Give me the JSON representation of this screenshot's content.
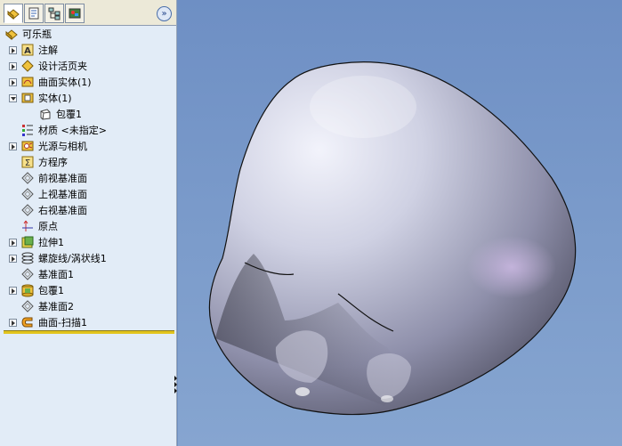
{
  "panel": {
    "tabs": [
      {
        "name": "feature-manager"
      },
      {
        "name": "property-manager"
      },
      {
        "name": "configuration-manager"
      },
      {
        "name": "display-manager"
      }
    ],
    "expand_glyph": "»"
  },
  "tree": {
    "root": "可乐瓶",
    "items": [
      {
        "label": "注解",
        "icon": "annotation-icon",
        "expander": "collapsed"
      },
      {
        "label": "设计活页夹",
        "icon": "design-binder-icon",
        "expander": "collapsed"
      },
      {
        "label": "曲面实体(1)",
        "icon": "surface-bodies-icon",
        "expander": "collapsed"
      },
      {
        "label": "实体(1)",
        "icon": "solid-bodies-icon",
        "expander": "expanded"
      },
      {
        "label": "包覆1",
        "icon": "body-icon",
        "expander": "none",
        "indent": true
      },
      {
        "label": "材质 <未指定>",
        "icon": "material-icon",
        "expander": "none"
      },
      {
        "label": "光源与相机",
        "icon": "lights-cameras-icon",
        "expander": "collapsed"
      },
      {
        "label": "方程序",
        "icon": "equations-icon",
        "expander": "none"
      },
      {
        "label": "前视基准面",
        "icon": "plane-icon",
        "expander": "none"
      },
      {
        "label": "上视基准面",
        "icon": "plane-icon",
        "expander": "none"
      },
      {
        "label": "右视基准面",
        "icon": "plane-icon",
        "expander": "none"
      },
      {
        "label": "原点",
        "icon": "origin-icon",
        "expander": "none"
      },
      {
        "label": "拉伸1",
        "icon": "extrude-icon",
        "expander": "collapsed"
      },
      {
        "label": "螺旋线/涡状线1",
        "icon": "helix-icon",
        "expander": "collapsed"
      },
      {
        "label": "基准面1",
        "icon": "plane-icon",
        "expander": "none"
      },
      {
        "label": "包覆1",
        "icon": "wrap-icon",
        "expander": "collapsed"
      },
      {
        "label": "基准面2",
        "icon": "plane-icon",
        "expander": "none"
      },
      {
        "label": "曲面-扫描1",
        "icon": "swept-surface-icon",
        "expander": "collapsed"
      }
    ]
  },
  "colors": {
    "panel_bg": "#e2ecf7",
    "viewport_bg": "#7393c6",
    "rollback_bar": "#e2c41e"
  }
}
